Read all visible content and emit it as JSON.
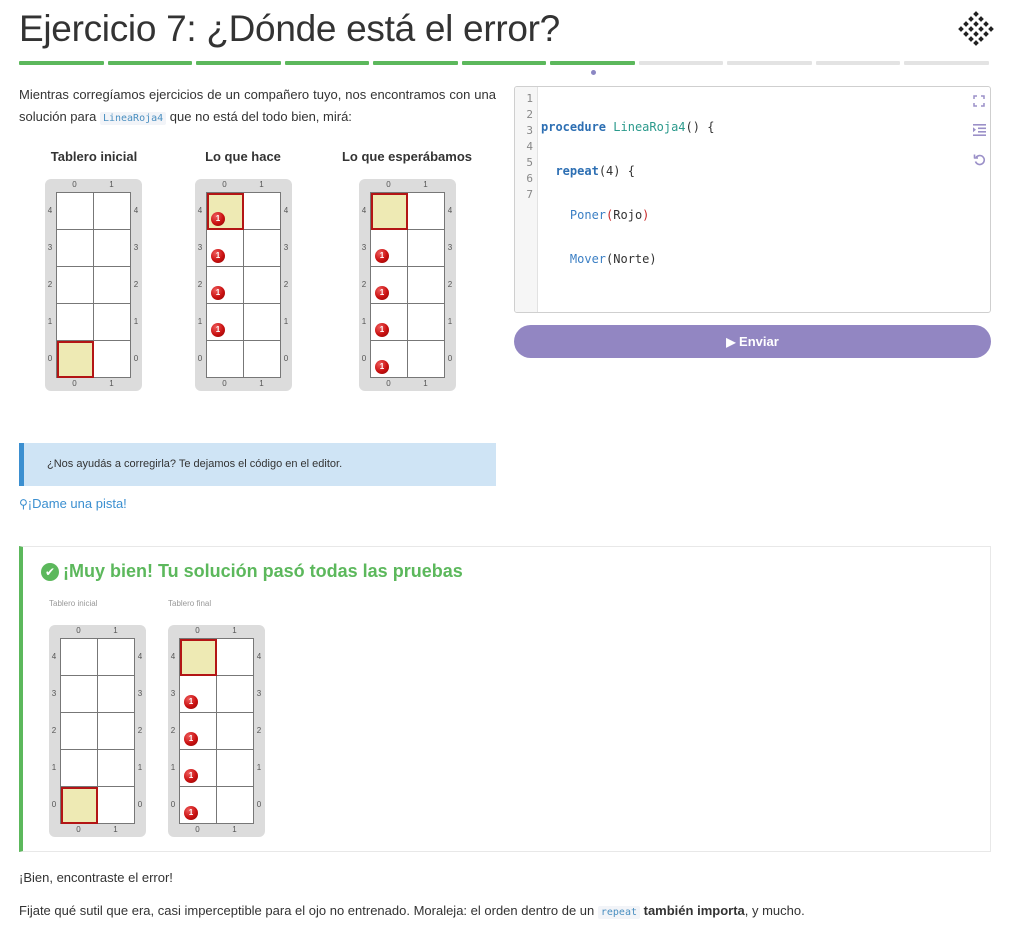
{
  "title": "Ejercicio 7: ¿Dónde está el error?",
  "progress": {
    "total": 11,
    "done": 7,
    "current_index": 6
  },
  "intro": {
    "text_before": "Mientras corregíamos ejercicios de un compañero tuyo, nos encontramos con una solución para",
    "code": "LineaRoja4",
    "text_after": "que no está del todo bien, mirá:"
  },
  "boards": {
    "initial": {
      "label": "Tablero inicial",
      "cols": [
        "0",
        "1"
      ],
      "rows": [
        "4",
        "3",
        "2",
        "1",
        "0"
      ],
      "head": [
        0,
        0
      ],
      "balls": []
    },
    "actual": {
      "label": "Lo que hace",
      "cols": [
        "0",
        "1"
      ],
      "rows": [
        "4",
        "3",
        "2",
        "1",
        "0"
      ],
      "head": [
        0,
        4
      ],
      "balls": [
        {
          "x": 0,
          "y": 4,
          "n": "1"
        },
        {
          "x": 0,
          "y": 3,
          "n": "1"
        },
        {
          "x": 0,
          "y": 2,
          "n": "1"
        },
        {
          "x": 0,
          "y": 1,
          "n": "1"
        }
      ]
    },
    "expected": {
      "label": "Lo que esperábamos",
      "cols": [
        "0",
        "1"
      ],
      "rows": [
        "4",
        "3",
        "2",
        "1",
        "0"
      ],
      "head": [
        0,
        4
      ],
      "balls": [
        {
          "x": 0,
          "y": 3,
          "n": "1"
        },
        {
          "x": 0,
          "y": 2,
          "n": "1"
        },
        {
          "x": 0,
          "y": 1,
          "n": "1"
        },
        {
          "x": 0,
          "y": 0,
          "n": "1"
        }
      ]
    }
  },
  "hint_box": "¿Nos ayudás a corregirla? Te dejamos el código en el editor.",
  "hint_link": "¡Dame una pista!",
  "editor": {
    "line_numbers": [
      "1",
      "2",
      "3",
      "4",
      "5",
      "6",
      "7"
    ],
    "tools": [
      "fullscreen-icon",
      "indent-icon",
      "reset-icon"
    ]
  },
  "send_button": "Enviar",
  "result": {
    "title": "¡Muy bien! Tu solución pasó todas las pruebas",
    "initial_label": "Tablero inicial",
    "final_label": "Tablero final",
    "initial": {
      "cols": [
        "0",
        "1"
      ],
      "rows": [
        "4",
        "3",
        "2",
        "1",
        "0"
      ],
      "head": [
        0,
        0
      ],
      "balls": []
    },
    "final": {
      "cols": [
        "0",
        "1"
      ],
      "rows": [
        "4",
        "3",
        "2",
        "1",
        "0"
      ],
      "head": [
        0,
        4
      ],
      "balls": [
        {
          "x": 0,
          "y": 3,
          "n": "1"
        },
        {
          "x": 0,
          "y": 2,
          "n": "1"
        },
        {
          "x": 0,
          "y": 1,
          "n": "1"
        },
        {
          "x": 0,
          "y": 0,
          "n": "1"
        }
      ]
    }
  },
  "bottom": {
    "line1": "¡Bien, encontraste el error!",
    "line2_before": "Fijate qué sutil que era, casi imperceptible para el ojo no entrenado. Moraleja: el orden dentro de un",
    "line2_code": "repeat",
    "line2_bold": "también importa",
    "line2_after": ", y mucho."
  },
  "colors": {
    "accent": "#9286c2",
    "success": "#5cb85c",
    "info_bg": "#cfe4f5",
    "info_border": "#3b8fd0",
    "head_fill": "#eeeab4",
    "head_border": "#b31515"
  }
}
